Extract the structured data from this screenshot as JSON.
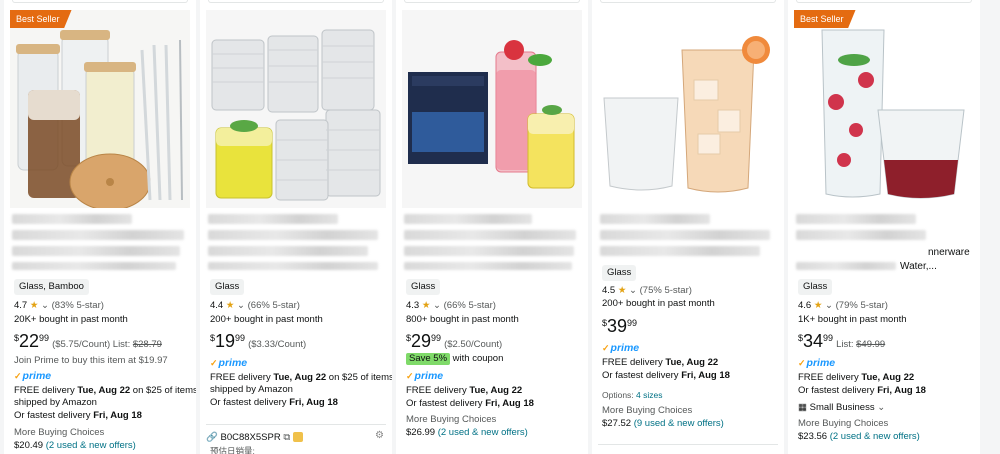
{
  "cards": [
    {
      "badge": "Best Seller",
      "partial_title": "",
      "chip": "Glass, Bamboo",
      "rating": "4.7",
      "star": "★",
      "rating_detail": "(83% 5-star)",
      "bought": "20K+ bought in past month",
      "price": {
        "sym": "$",
        "whole": "22",
        "frac": "99",
        "extra": "($5.75/Count) List: ",
        "list": "$28.79"
      },
      "promo": "Join Prime to buy this item at $19.97",
      "prime": "prime",
      "delivery_1a": "FREE delivery ",
      "delivery_1b": "Tue, Aug 22",
      "delivery_1c": " on $25 of items",
      "delivery_2": "shipped by Amazon",
      "fastest_a": "Or fastest delivery ",
      "fastest_b": "Fri, Aug 18",
      "more": "More Buying Choices",
      "offer_price": "$20.49",
      "offers": "(2 used & new offers)"
    },
    {
      "chip": "Glass",
      "rating": "4.4",
      "star": "★",
      "rating_detail": "(66% 5-star)",
      "bought": "200+ bought in past month",
      "price": {
        "sym": "$",
        "whole": "19",
        "frac": "99",
        "extra": "($3.33/Count)"
      },
      "prime": "prime",
      "delivery_1a": "FREE delivery ",
      "delivery_1b": "Tue, Aug 22",
      "delivery_1c": " on $25 of items",
      "delivery_2": "shipped by Amazon",
      "fastest_a": "Or fastest delivery ",
      "fastest_b": "Fri, Aug 18",
      "asin": "B0C88X5SPR",
      "asin_sub": "预估日销量:"
    },
    {
      "chip": "Glass",
      "rating": "4.3",
      "star": "★",
      "rating_detail": "(66% 5-star)",
      "bought": "800+ bought in past month",
      "price": {
        "sym": "$",
        "whole": "29",
        "frac": "99",
        "extra": "($2.50/Count)"
      },
      "save": "Save 5%",
      "save_suffix": " with coupon",
      "prime": "prime",
      "delivery_1a": "FREE delivery ",
      "delivery_1b": "Tue, Aug 22",
      "fastest_a": "Or fastest delivery ",
      "fastest_b": "Fri, Aug 18",
      "more": "More Buying Choices",
      "offer_price": "$26.99",
      "offers": "(2 used & new offers)"
    },
    {
      "chip": "Glass",
      "rating": "4.5",
      "star": "★",
      "rating_detail": "(75% 5-star)",
      "bought": "200+ bought in past month",
      "price": {
        "sym": "$",
        "whole": "39",
        "frac": "99"
      },
      "prime": "prime",
      "delivery_1a": "FREE delivery ",
      "delivery_1b": "Tue, Aug 22",
      "fastest_a": "Or fastest delivery ",
      "fastest_b": "Fri, Aug 18",
      "options": "Options: ",
      "sizes": "4 sizes",
      "more": "More Buying Choices",
      "offer_price": "$27.52",
      "offers": "(9 used & new offers)"
    },
    {
      "badge": "Best Seller",
      "partial_title_a": "nnerware",
      "partial_title_b": "Water,...",
      "chip": "Glass",
      "rating": "4.6",
      "star": "★",
      "rating_detail": "(79% 5-star)",
      "bought": "1K+ bought in past month",
      "price": {
        "sym": "$",
        "whole": "34",
        "frac": "99",
        "extra": "List: ",
        "list": "$49.99"
      },
      "prime": "prime",
      "delivery_1a": "FREE delivery ",
      "delivery_1b": "Tue, Aug 22",
      "fastest_a": "Or fastest delivery ",
      "fastest_b": "Fri, Aug 18",
      "small_business": "Small Business",
      "more": "More Buying Choices",
      "offer_price": "$23.56",
      "offers": "(2 used & new offers)"
    }
  ]
}
